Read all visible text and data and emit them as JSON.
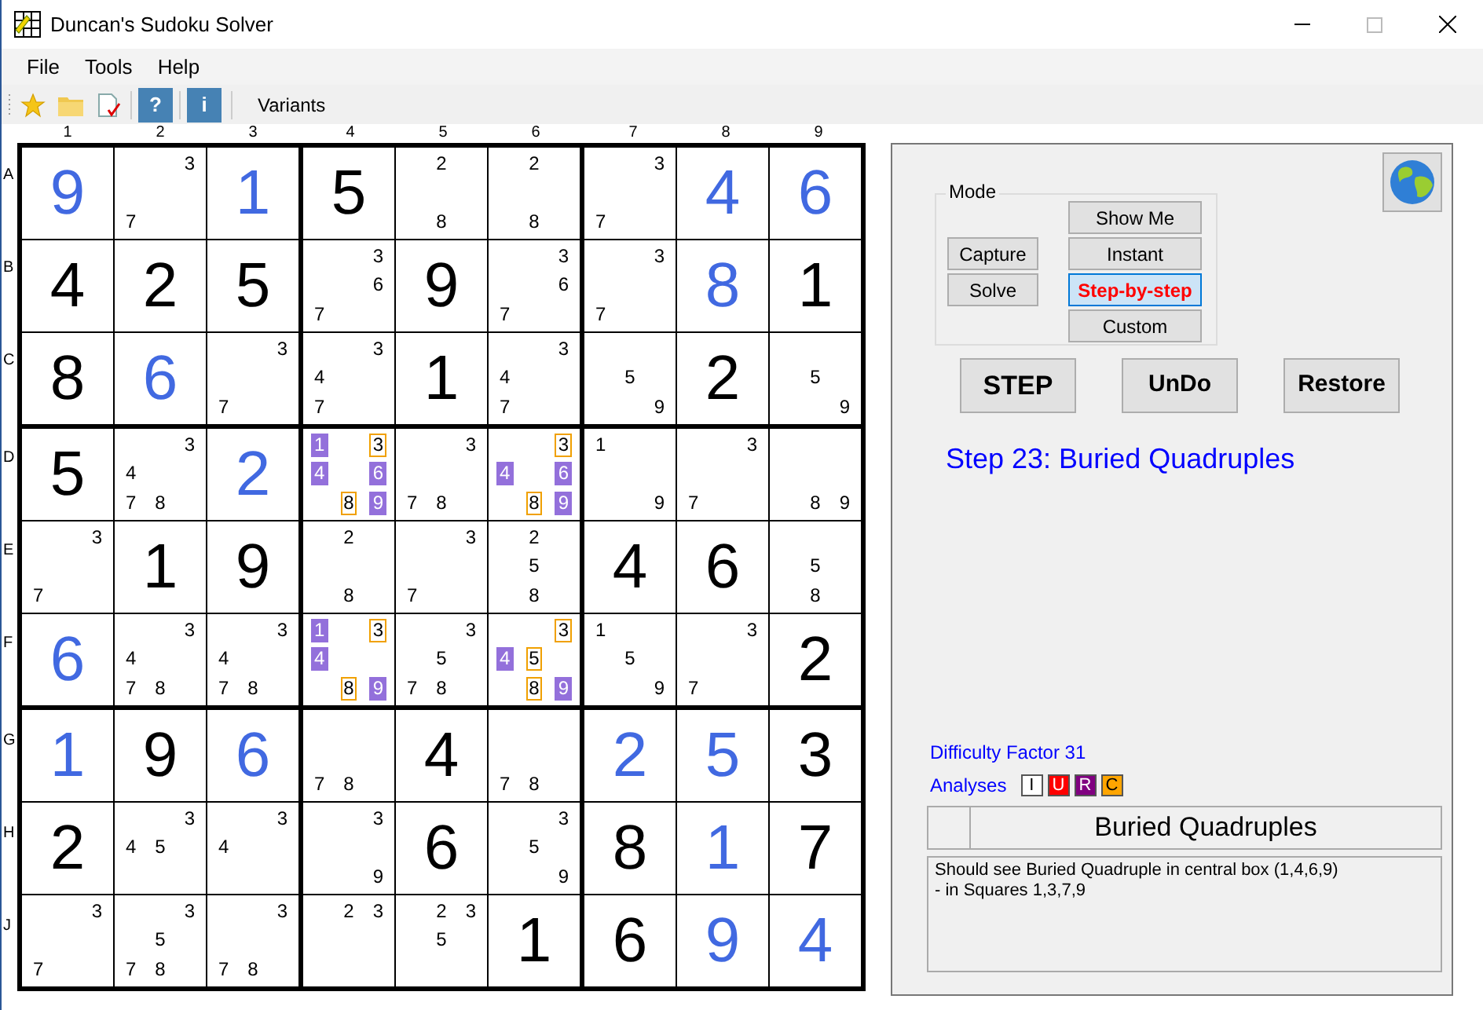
{
  "window": {
    "title": "Duncan's Sudoku Solver"
  },
  "menu": [
    {
      "label": "File"
    },
    {
      "label": "Tools"
    },
    {
      "label": "Help"
    }
  ],
  "toolbar": {
    "help_label": "?",
    "info_label": "i",
    "variants": "Variants"
  },
  "column_labels": [
    "1",
    "2",
    "3",
    "4",
    "5",
    "6",
    "7",
    "8",
    "9"
  ],
  "row_labels": [
    "A",
    "B",
    "C",
    "D",
    "E",
    "F",
    "G",
    "H",
    "J"
  ],
  "grid": [
    [
      {
        "kind": "solved",
        "value": "9"
      },
      {
        "kind": "pencil",
        "candidates": [
          {
            "digit": "3",
            "kind": "plain"
          },
          {
            "digit": "7",
            "kind": "plain"
          }
        ]
      },
      {
        "kind": "solved",
        "value": "1"
      },
      {
        "kind": "given",
        "value": "5"
      },
      {
        "kind": "pencil",
        "candidates": [
          {
            "digit": "2",
            "kind": "plain"
          },
          {
            "digit": "8",
            "kind": "plain"
          }
        ]
      },
      {
        "kind": "pencil",
        "candidates": [
          {
            "digit": "2",
            "kind": "plain"
          },
          {
            "digit": "8",
            "kind": "plain"
          }
        ]
      },
      {
        "kind": "pencil",
        "candidates": [
          {
            "digit": "3",
            "kind": "plain"
          },
          {
            "digit": "7",
            "kind": "plain"
          }
        ]
      },
      {
        "kind": "solved",
        "value": "4"
      },
      {
        "kind": "solved",
        "value": "6"
      }
    ],
    [
      {
        "kind": "given",
        "value": "4"
      },
      {
        "kind": "given",
        "value": "2"
      },
      {
        "kind": "given",
        "value": "5"
      },
      {
        "kind": "pencil",
        "candidates": [
          {
            "digit": "3",
            "kind": "plain"
          },
          {
            "digit": "6",
            "kind": "plain"
          },
          {
            "digit": "7",
            "kind": "plain"
          }
        ]
      },
      {
        "kind": "given",
        "value": "9"
      },
      {
        "kind": "pencil",
        "candidates": [
          {
            "digit": "3",
            "kind": "plain"
          },
          {
            "digit": "6",
            "kind": "plain"
          },
          {
            "digit": "7",
            "kind": "plain"
          }
        ]
      },
      {
        "kind": "pencil",
        "candidates": [
          {
            "digit": "3",
            "kind": "plain"
          },
          {
            "digit": "7",
            "kind": "plain"
          }
        ]
      },
      {
        "kind": "solved",
        "value": "8"
      },
      {
        "kind": "given",
        "value": "1"
      }
    ],
    [
      {
        "kind": "given",
        "value": "8"
      },
      {
        "kind": "solved",
        "value": "6"
      },
      {
        "kind": "pencil",
        "candidates": [
          {
            "digit": "3",
            "kind": "plain"
          },
          {
            "digit": "7",
            "kind": "plain"
          }
        ]
      },
      {
        "kind": "pencil",
        "candidates": [
          {
            "digit": "3",
            "kind": "plain"
          },
          {
            "digit": "4",
            "kind": "plain"
          },
          {
            "digit": "7",
            "kind": "plain"
          }
        ]
      },
      {
        "kind": "given",
        "value": "1"
      },
      {
        "kind": "pencil",
        "candidates": [
          {
            "digit": "3",
            "kind": "plain"
          },
          {
            "digit": "4",
            "kind": "plain"
          },
          {
            "digit": "7",
            "kind": "plain"
          }
        ]
      },
      {
        "kind": "pencil",
        "candidates": [
          {
            "digit": "5",
            "kind": "plain"
          },
          {
            "digit": "9",
            "kind": "plain"
          }
        ]
      },
      {
        "kind": "given",
        "value": "2"
      },
      {
        "kind": "pencil",
        "candidates": [
          {
            "digit": "5",
            "kind": "plain"
          },
          {
            "digit": "9",
            "kind": "plain"
          }
        ]
      }
    ],
    [
      {
        "kind": "given",
        "value": "5"
      },
      {
        "kind": "pencil",
        "candidates": [
          {
            "digit": "3",
            "kind": "plain"
          },
          {
            "digit": "4",
            "kind": "plain"
          },
          {
            "digit": "7",
            "kind": "plain"
          },
          {
            "digit": "8",
            "kind": "plain"
          }
        ]
      },
      {
        "kind": "solved",
        "value": "2"
      },
      {
        "kind": "pencil",
        "candidates": [
          {
            "digit": "1",
            "kind": "filled"
          },
          {
            "digit": "3",
            "kind": "boxed"
          },
          {
            "digit": "4",
            "kind": "filled"
          },
          {
            "digit": "6",
            "kind": "filled"
          },
          {
            "digit": "8",
            "kind": "boxed"
          },
          {
            "digit": "9",
            "kind": "filled"
          }
        ]
      },
      {
        "kind": "pencil",
        "candidates": [
          {
            "digit": "3",
            "kind": "plain"
          },
          {
            "digit": "7",
            "kind": "plain"
          },
          {
            "digit": "8",
            "kind": "plain"
          }
        ]
      },
      {
        "kind": "pencil",
        "candidates": [
          {
            "digit": "3",
            "kind": "boxed"
          },
          {
            "digit": "4",
            "kind": "filled"
          },
          {
            "digit": "6",
            "kind": "filled"
          },
          {
            "digit": "8",
            "kind": "boxed"
          },
          {
            "digit": "9",
            "kind": "filled"
          }
        ]
      },
      {
        "kind": "pencil",
        "candidates": [
          {
            "digit": "1",
            "kind": "plain"
          },
          {
            "digit": "9",
            "kind": "plain"
          }
        ]
      },
      {
        "kind": "pencil",
        "candidates": [
          {
            "digit": "3",
            "kind": "plain"
          },
          {
            "digit": "7",
            "kind": "plain"
          }
        ]
      },
      {
        "kind": "pencil",
        "candidates": [
          {
            "digit": "8",
            "kind": "plain"
          },
          {
            "digit": "9",
            "kind": "plain"
          }
        ]
      }
    ],
    [
      {
        "kind": "pencil",
        "candidates": [
          {
            "digit": "3",
            "kind": "plain"
          },
          {
            "digit": "7",
            "kind": "plain"
          }
        ]
      },
      {
        "kind": "given",
        "value": "1"
      },
      {
        "kind": "given",
        "value": "9"
      },
      {
        "kind": "pencil",
        "candidates": [
          {
            "digit": "2",
            "kind": "plain"
          },
          {
            "digit": "8",
            "kind": "plain"
          }
        ]
      },
      {
        "kind": "pencil",
        "candidates": [
          {
            "digit": "3",
            "kind": "plain"
          },
          {
            "digit": "7",
            "kind": "plain"
          }
        ]
      },
      {
        "kind": "pencil",
        "candidates": [
          {
            "digit": "2",
            "kind": "plain"
          },
          {
            "digit": "5",
            "kind": "plain"
          },
          {
            "digit": "8",
            "kind": "plain"
          }
        ]
      },
      {
        "kind": "given",
        "value": "4"
      },
      {
        "kind": "given",
        "value": "6"
      },
      {
        "kind": "pencil",
        "candidates": [
          {
            "digit": "5",
            "kind": "plain"
          },
          {
            "digit": "8",
            "kind": "plain"
          }
        ]
      }
    ],
    [
      {
        "kind": "solved",
        "value": "6"
      },
      {
        "kind": "pencil",
        "candidates": [
          {
            "digit": "3",
            "kind": "plain"
          },
          {
            "digit": "4",
            "kind": "plain"
          },
          {
            "digit": "7",
            "kind": "plain"
          },
          {
            "digit": "8",
            "kind": "plain"
          }
        ]
      },
      {
        "kind": "pencil",
        "candidates": [
          {
            "digit": "3",
            "kind": "plain"
          },
          {
            "digit": "4",
            "kind": "plain"
          },
          {
            "digit": "7",
            "kind": "plain"
          },
          {
            "digit": "8",
            "kind": "plain"
          }
        ]
      },
      {
        "kind": "pencil",
        "candidates": [
          {
            "digit": "1",
            "kind": "filled"
          },
          {
            "digit": "3",
            "kind": "boxed"
          },
          {
            "digit": "4",
            "kind": "filled"
          },
          {
            "digit": "8",
            "kind": "boxed"
          },
          {
            "digit": "9",
            "kind": "filled"
          }
        ]
      },
      {
        "kind": "pencil",
        "candidates": [
          {
            "digit": "3",
            "kind": "plain"
          },
          {
            "digit": "5",
            "kind": "plain"
          },
          {
            "digit": "7",
            "kind": "plain"
          },
          {
            "digit": "8",
            "kind": "plain"
          }
        ]
      },
      {
        "kind": "pencil",
        "candidates": [
          {
            "digit": "3",
            "kind": "boxed"
          },
          {
            "digit": "4",
            "kind": "filled"
          },
          {
            "digit": "5",
            "kind": "boxed"
          },
          {
            "digit": "8",
            "kind": "boxed"
          },
          {
            "digit": "9",
            "kind": "filled"
          }
        ]
      },
      {
        "kind": "pencil",
        "candidates": [
          {
            "digit": "1",
            "kind": "plain"
          },
          {
            "digit": "5",
            "kind": "plain"
          },
          {
            "digit": "9",
            "kind": "plain"
          }
        ]
      },
      {
        "kind": "pencil",
        "candidates": [
          {
            "digit": "3",
            "kind": "plain"
          },
          {
            "digit": "7",
            "kind": "plain"
          }
        ]
      },
      {
        "kind": "given",
        "value": "2"
      }
    ],
    [
      {
        "kind": "solved",
        "value": "1"
      },
      {
        "kind": "given",
        "value": "9"
      },
      {
        "kind": "solved",
        "value": "6"
      },
      {
        "kind": "pencil",
        "candidates": [
          {
            "digit": "7",
            "kind": "plain"
          },
          {
            "digit": "8",
            "kind": "plain"
          }
        ]
      },
      {
        "kind": "given",
        "value": "4"
      },
      {
        "kind": "pencil",
        "candidates": [
          {
            "digit": "7",
            "kind": "plain"
          },
          {
            "digit": "8",
            "kind": "plain"
          }
        ]
      },
      {
        "kind": "solved",
        "value": "2"
      },
      {
        "kind": "solved",
        "value": "5"
      },
      {
        "kind": "given",
        "value": "3"
      }
    ],
    [
      {
        "kind": "given",
        "value": "2"
      },
      {
        "kind": "pencil",
        "candidates": [
          {
            "digit": "3",
            "kind": "plain"
          },
          {
            "digit": "4",
            "kind": "plain"
          },
          {
            "digit": "5",
            "kind": "plain"
          }
        ]
      },
      {
        "kind": "pencil",
        "candidates": [
          {
            "digit": "3",
            "kind": "plain"
          },
          {
            "digit": "4",
            "kind": "plain"
          }
        ]
      },
      {
        "kind": "pencil",
        "candidates": [
          {
            "digit": "3",
            "kind": "plain"
          },
          {
            "digit": "9",
            "kind": "plain"
          }
        ]
      },
      {
        "kind": "given",
        "value": "6"
      },
      {
        "kind": "pencil",
        "candidates": [
          {
            "digit": "3",
            "kind": "plain"
          },
          {
            "digit": "5",
            "kind": "plain"
          },
          {
            "digit": "9",
            "kind": "plain"
          }
        ]
      },
      {
        "kind": "given",
        "value": "8"
      },
      {
        "kind": "solved",
        "value": "1"
      },
      {
        "kind": "given",
        "value": "7"
      }
    ],
    [
      {
        "kind": "pencil",
        "candidates": [
          {
            "digit": "3",
            "kind": "plain"
          },
          {
            "digit": "7",
            "kind": "plain"
          }
        ]
      },
      {
        "kind": "pencil",
        "candidates": [
          {
            "digit": "3",
            "kind": "plain"
          },
          {
            "digit": "5",
            "kind": "plain"
          },
          {
            "digit": "7",
            "kind": "plain"
          },
          {
            "digit": "8",
            "kind": "plain"
          }
        ]
      },
      {
        "kind": "pencil",
        "candidates": [
          {
            "digit": "3",
            "kind": "plain"
          },
          {
            "digit": "7",
            "kind": "plain"
          },
          {
            "digit": "8",
            "kind": "plain"
          }
        ]
      },
      {
        "kind": "pencil",
        "candidates": [
          {
            "digit": "2",
            "kind": "plain"
          },
          {
            "digit": "3",
            "kind": "plain"
          }
        ]
      },
      {
        "kind": "pencil",
        "candidates": [
          {
            "digit": "2",
            "kind": "plain"
          },
          {
            "digit": "3",
            "kind": "plain"
          },
          {
            "digit": "5",
            "kind": "plain"
          }
        ]
      },
      {
        "kind": "given",
        "value": "1"
      },
      {
        "kind": "given",
        "value": "6"
      },
      {
        "kind": "solved",
        "value": "9"
      },
      {
        "kind": "solved",
        "value": "4"
      }
    ]
  ],
  "mode": {
    "title": "Mode",
    "left_buttons": [
      {
        "label": "Capture"
      },
      {
        "label": "Solve"
      }
    ],
    "options": [
      {
        "label": "Show Me",
        "selected": false
      },
      {
        "label": "Instant",
        "selected": false
      },
      {
        "label": "Step-by-step",
        "selected": true
      },
      {
        "label": "Custom",
        "selected": false
      }
    ]
  },
  "actions": [
    {
      "label": "STEP"
    },
    {
      "label": "UnDo"
    },
    {
      "label": "Restore"
    }
  ],
  "step_title": "Step 23: Buried Quadruples",
  "difficulty": "Difficulty Factor 31",
  "analyses": {
    "label": "Analyses",
    "badges": [
      {
        "label": "I",
        "color": "#ffffff"
      },
      {
        "label": "U",
        "color": "#ff0000"
      },
      {
        "label": "R",
        "color": "#800080"
      },
      {
        "label": "C",
        "color": "#ffa500"
      }
    ]
  },
  "technique": {
    "name": "Buried Quadruples"
  },
  "explanation": [
    "Should see Buried Quadruple in central box (1,4,6,9)",
    "- in Squares 1,3,7,9"
  ]
}
